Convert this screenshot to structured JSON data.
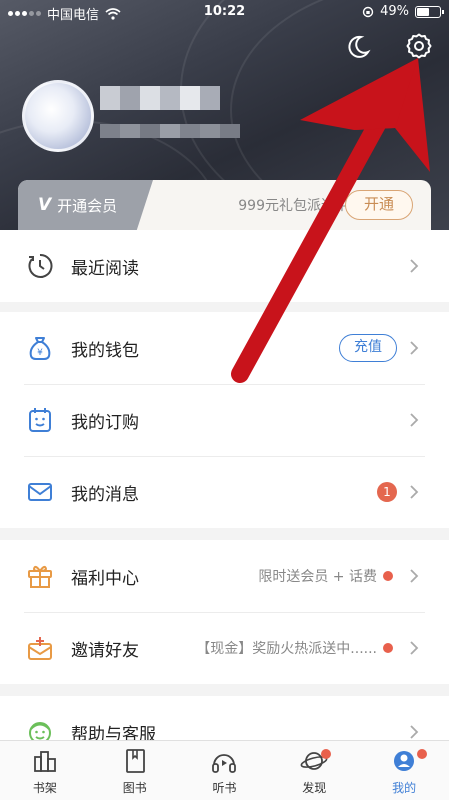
{
  "status_bar": {
    "carrier": "中国电信",
    "time": "10:22",
    "battery": "49%"
  },
  "header": {
    "moon_icon": "moon-icon",
    "settings_icon": "gear-icon"
  },
  "vip": {
    "tag_label": "开通会员",
    "promo": "999元礼包派送中",
    "button": "开通"
  },
  "recent": {
    "label": "最近阅读"
  },
  "account": {
    "wallet": {
      "label": "我的钱包",
      "button": "充值"
    },
    "orders": {
      "label": "我的订购"
    },
    "messages": {
      "label": "我的消息",
      "badge": "1"
    }
  },
  "benefits": {
    "welfare": {
      "label": "福利中心",
      "extra": "限时送会员 + 话费"
    },
    "invite": {
      "label": "邀请好友",
      "extra": "【现金】奖励火热派送中......"
    }
  },
  "help": {
    "label": "帮助与客服"
  },
  "tabs": [
    {
      "label": "书架",
      "icon": "bookshelf-icon"
    },
    {
      "label": "图书",
      "icon": "book-icon"
    },
    {
      "label": "听书",
      "icon": "headphones-icon"
    },
    {
      "label": "发现",
      "icon": "planet-icon"
    },
    {
      "label": "我的",
      "icon": "profile-icon"
    }
  ],
  "colors": {
    "accent_blue": "#3f7fd6",
    "vip_gold": "#c98d55",
    "badge_red": "#e4674f",
    "arrow_red": "#c8131b"
  }
}
